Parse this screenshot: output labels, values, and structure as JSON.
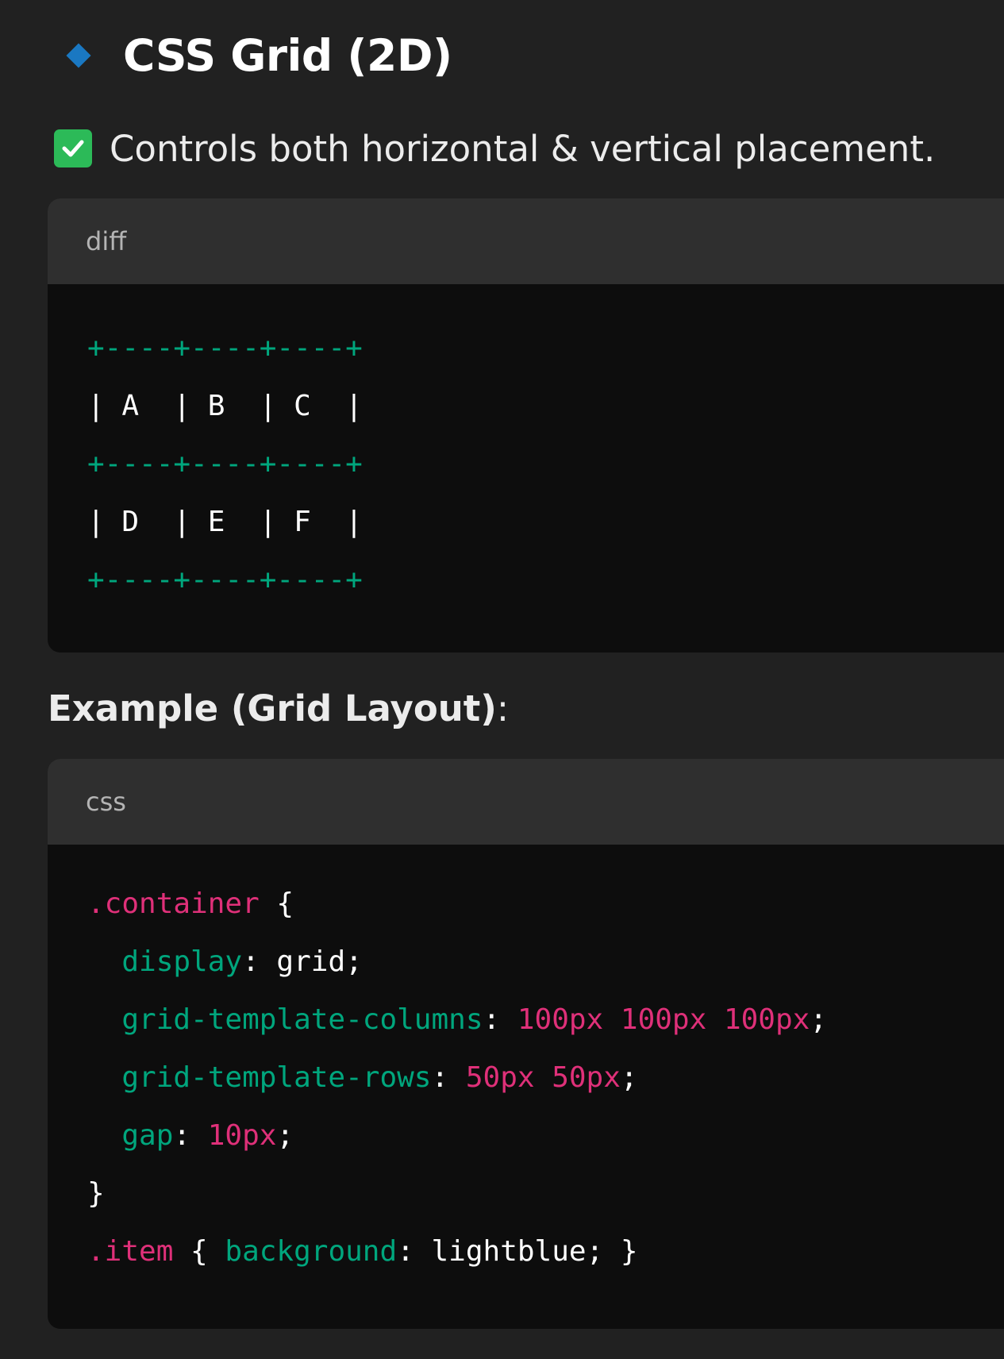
{
  "heading": {
    "icon": "blue-diamond-icon",
    "title": "CSS Grid (2D)"
  },
  "check_item": {
    "icon": "check-mark-icon",
    "text": "Controls both horizontal & vertical placement."
  },
  "diff_block": {
    "language": "diff",
    "lines": [
      "+----+----+----+",
      "| A  | B  | C  |",
      "+----+----+----+",
      "| D  | E  | F  |",
      "+----+----+----+"
    ]
  },
  "example_title": {
    "text": "Example (Grid Layout)",
    "colon": ":"
  },
  "css_block": {
    "language": "css",
    "lines": [
      [
        {
          "t": ".container",
          "c": "pink"
        },
        {
          "t": " {",
          "c": "white"
        }
      ],
      [
        {
          "t": "  display",
          "c": "green"
        },
        {
          "t": ": grid;",
          "c": "white"
        }
      ],
      [
        {
          "t": "  grid-template-columns",
          "c": "green"
        },
        {
          "t": ": ",
          "c": "white"
        },
        {
          "t": "100px 100px 100px",
          "c": "pink"
        },
        {
          "t": ";",
          "c": "white"
        }
      ],
      [
        {
          "t": "  grid-template-rows",
          "c": "green"
        },
        {
          "t": ": ",
          "c": "white"
        },
        {
          "t": "50px 50px",
          "c": "pink"
        },
        {
          "t": ";",
          "c": "white"
        }
      ],
      [
        {
          "t": "  gap",
          "c": "green"
        },
        {
          "t": ": ",
          "c": "white"
        },
        {
          "t": "10px",
          "c": "pink"
        },
        {
          "t": ";",
          "c": "white"
        }
      ],
      [
        {
          "t": "}",
          "c": "white"
        }
      ],
      [
        {
          "t": ".item",
          "c": "pink"
        },
        {
          "t": " { ",
          "c": "white"
        },
        {
          "t": "background",
          "c": "green"
        },
        {
          "t": ": lightblue; }",
          "c": "white"
        }
      ]
    ]
  },
  "colors": {
    "background": "#212121",
    "code_background": "#0d0d0d",
    "code_header": "#2f2f2f",
    "accent_blue": "#1a78c2",
    "check_green": "#2cba58",
    "code_green": "#00a67d",
    "code_pink": "#df3079"
  }
}
